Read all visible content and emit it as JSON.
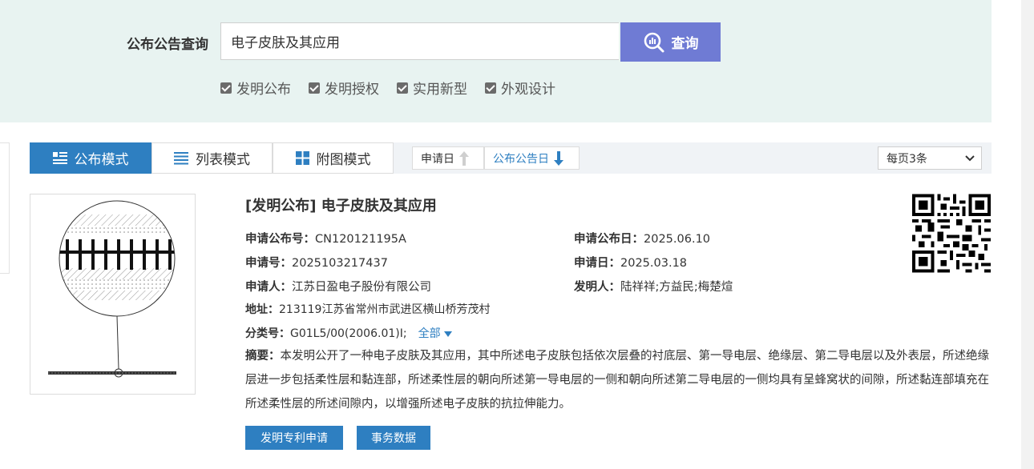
{
  "search": {
    "label": "公布公告查询",
    "value": "电子皮肤及其应用",
    "button_label": "查询",
    "checkboxes": [
      {
        "label": "发明公布",
        "checked": true
      },
      {
        "label": "发明授权",
        "checked": true
      },
      {
        "label": "实用新型",
        "checked": true
      },
      {
        "label": "外观设计",
        "checked": true
      }
    ]
  },
  "toolbar": {
    "modes": [
      {
        "label": "公布模式",
        "active": true,
        "icon": "publish-list-icon"
      },
      {
        "label": "列表模式",
        "active": false,
        "icon": "list-icon"
      },
      {
        "label": "附图模式",
        "active": false,
        "icon": "grid-icon"
      }
    ],
    "sort": [
      {
        "label": "申请日",
        "direction": "up",
        "active": false
      },
      {
        "label": "公布公告日",
        "direction": "down",
        "active": true
      }
    ],
    "per_page": "每页3条"
  },
  "result": {
    "title": "[发明公布] 电子皮肤及其应用",
    "pub_no_label": "申请公布号：",
    "pub_no": "CN120121195A",
    "pub_date_label": "申请公布日：",
    "pub_date": "2025.06.10",
    "app_no_label": "申请号：",
    "app_no": "2025103217437",
    "app_date_label": "申请日：",
    "app_date": "2025.03.18",
    "applicant_label": "申请人：",
    "applicant": "江苏日盈电子股份有限公司",
    "inventor_label": "发明人：",
    "inventor": "陆祥祥;方益民;梅楚煊",
    "address_label": "地址：",
    "address": "213119江苏省常州市武进区横山桥芳茂村",
    "class_label": "分类号：",
    "class_no": "G01L5/00(2006.01)I;",
    "expand_label": "全部",
    "abstract_label": "摘要：",
    "abstract": "本发明公开了一种电子皮肤及其应用，其中所述电子皮肤包括依次层叠的衬底层、第一导电层、绝缘层、第二导电层以及外表层，所述绝缘层进一步包括柔性层和黏连部，所述柔性层的朝向所述第一导电层的一侧和朝向所述第二导电层的一侧均具有呈蜂窝状的间隙，所述黏连部填充在所述柔性层的所述间隙内，以增强所述电子皮肤的抗拉伸能力。",
    "buttons": [
      "发明专利申请",
      "事务数据"
    ]
  },
  "colors": {
    "accent": "#2e7fc1",
    "search_button": "#6f7bd4",
    "panel_bg": "#e8f3f1"
  }
}
